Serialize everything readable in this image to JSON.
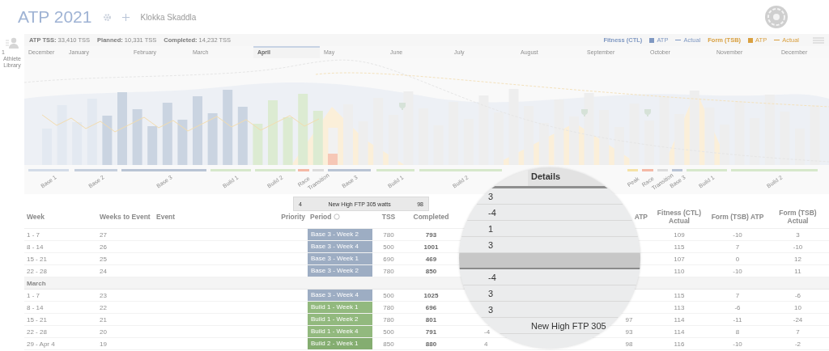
{
  "header": {
    "title": "ATP 2021",
    "athlete": "Klokka Skaddla"
  },
  "sidebar": {
    "badge": "1",
    "label": "Athlete Library"
  },
  "summary": [
    "**ATP TSS:** 33,410 TSS",
    "**Planned:** 10,331 TSS",
    "**Completed:** 14,232 TSS"
  ],
  "legend": [
    {
      "title": "Fitness (CTL)",
      "color": "#7f98c2",
      "items": [
        {
          "kind": "area",
          "label": "ATP"
        },
        {
          "kind": "line",
          "label": "Actual"
        }
      ]
    },
    {
      "title": "Form (TSB)",
      "color": "#d9a040",
      "items": [
        {
          "kind": "area",
          "label": "ATP"
        },
        {
          "kind": "line",
          "label": "Actual"
        }
      ]
    }
  ],
  "months": [
    {
      "label": "December",
      "selected": false
    },
    {
      "label": "January",
      "selected": false
    },
    {
      "label": "February",
      "selected": false
    },
    {
      "label": "March",
      "selected": false
    },
    {
      "label": "April",
      "selected": true
    },
    {
      "label": "May",
      "selected": false
    },
    {
      "label": "June",
      "selected": false
    },
    {
      "label": "July",
      "selected": false
    },
    {
      "label": "August",
      "selected": false
    },
    {
      "label": "September",
      "selected": false
    },
    {
      "label": "October",
      "selected": false
    },
    {
      "label": "November",
      "selected": false
    },
    {
      "label": "December",
      "selected": false
    }
  ],
  "phases": [
    {
      "label": "Base 1",
      "color": "#d3dce8"
    },
    {
      "label": "Base 2",
      "color": "#c5cfdd"
    },
    {
      "label": "Base 3",
      "color": "#b9c4d4"
    },
    {
      "label": "Build 1",
      "color": "#d6e8cb"
    },
    {
      "label": "Build 2",
      "color": "#d6e8cb"
    },
    {
      "label": "Race",
      "color": "#f4b9a6"
    },
    {
      "label": "Transition",
      "color": "#dcdcdc"
    },
    {
      "label": "Base 3",
      "color": "#b9c4d4"
    },
    {
      "label": "Build 1",
      "color": "#d6e8cb"
    },
    {
      "label": "Build 2",
      "color": "#d6e8cb"
    },
    {
      "label": "Peak",
      "color": "#f5e2a6"
    },
    {
      "label": "Race",
      "color": "#f4b9a6"
    },
    {
      "label": "Transition",
      "color": "#dcdcdc"
    },
    {
      "label": "Base 3",
      "color": "#b9c4d4"
    },
    {
      "label": "Build 1",
      "color": "#d6e8cb"
    },
    {
      "label": "Build 2",
      "color": "#d6e8cb"
    }
  ],
  "tooltip": [
    "4",
    "New High FTP 305 watts",
    "98"
  ],
  "table": {
    "columns": [
      {
        "label": "Week"
      },
      {
        "label": "Weeks to Event"
      },
      {
        "label": "Event"
      },
      {
        "label": "Priority"
      },
      {
        "label": "Period",
        "info": true
      },
      {
        "label": "TSS"
      },
      {
        "label": "Completed"
      },
      {
        "label": "ATP"
      },
      {
        "label": "Fitness (CTL) Actual"
      },
      {
        "label": "Form (TSB) ATP"
      },
      {
        "label": "Form (TSB) Actual"
      }
    ],
    "rows": [
      {
        "week": "1 - 7",
        "weeks_to_event": "27",
        "period": "Base 3 - Week 2",
        "color": "#9dadc3",
        "tss": "780",
        "completed": "793",
        "fitness_actual": "109",
        "form_atp": "-10",
        "form_actual": "3"
      },
      {
        "week": "8 - 14",
        "weeks_to_event": "26",
        "period": "Base 3 - Week 4",
        "color": "#9dadc3",
        "tss": "500",
        "completed": "1001",
        "fitness_actual": "115",
        "form_atp": "7",
        "form_actual": "-10"
      },
      {
        "week": "15 - 21",
        "weeks_to_event": "25",
        "period": "Base 3 - Week 1",
        "color": "#9dadc3",
        "tss": "690",
        "completed": "469",
        "fitness_actual": "107",
        "form_atp": "0",
        "form_actual": "12"
      },
      {
        "week": "22 - 28",
        "weeks_to_event": "24",
        "period": "Base 3 - Week 2",
        "color": "#9dadc3",
        "tss": "780",
        "completed": "850",
        "fitness_actual": "110",
        "form_atp": "-10",
        "form_actual": "11"
      },
      {
        "kind": "group",
        "label": "March"
      },
      {
        "week": "1 - 7",
        "weeks_to_event": "23",
        "period": "Base 3 - Week 4",
        "color": "#9dadc3",
        "tss": "500",
        "completed": "1025",
        "fitness_actual": "115",
        "form_atp": "7",
        "form_actual": "-6"
      },
      {
        "week": "8 - 14",
        "weeks_to_event": "22",
        "period": "Build 1 - Week 1",
        "color": "#92b97e",
        "tss": "780",
        "completed": "696",
        "fitness_actual": "113",
        "form_atp": "-6",
        "form_actual": "10"
      },
      {
        "week": "15 - 21",
        "weeks_to_event": "21",
        "period": "Build 1 - Week 2",
        "color": "#92b97e",
        "tss": "780",
        "completed": "801",
        "fitness_atp": "97",
        "fitness_actual": "114",
        "form_atp": "-11",
        "form_actual": "-24"
      },
      {
        "week": "22 - 28",
        "weeks_to_event": "20",
        "period": "Build 1 - Week 4",
        "color": "#92b97e",
        "tss": "500",
        "completed": "791",
        "column_8": "-4",
        "fitness_atp": "93",
        "fitness_actual": "114",
        "form_atp": "8",
        "form_actual": "7"
      },
      {
        "week": "29 - Apr 4",
        "weeks_to_event": "19",
        "period": "Build 2 - Week 1",
        "color": "#84ad70",
        "tss": "850",
        "completed": "880",
        "column_8": "4",
        "fitness_atp": "98",
        "fitness_actual": "116",
        "form_atp": "-10",
        "form_actual": "-2"
      }
    ]
  },
  "magnifier": {
    "header": "Details",
    "rows": [
      {
        "value": "3"
      },
      {
        "value": "-4"
      },
      {
        "value": "1"
      },
      {
        "value": "3"
      },
      {
        "kind": "group"
      },
      {
        "value": "-4"
      },
      {
        "value": "3"
      },
      {
        "value": "3"
      },
      {
        "details": "New High FTP 305"
      }
    ]
  }
}
